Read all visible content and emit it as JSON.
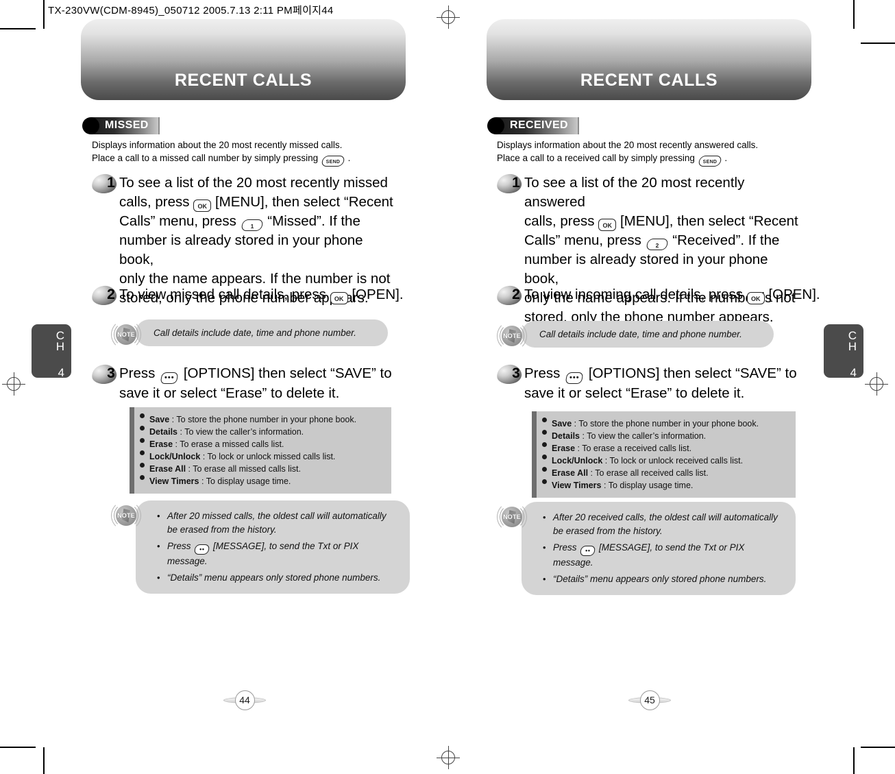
{
  "print_header": "TX-230VW(CDM-8945)_050712  2005.7.13 2:11 PM페이지44",
  "pages": [
    {
      "banner_title": "RECENT CALLS",
      "section_tag": "MISSED",
      "intro_line1": "Displays information about the 20 most recently missed calls.",
      "intro_line2_before": "Place a call to a missed call number by simply pressing",
      "intro_line2_after": ".",
      "send_key": "SEND",
      "step1": {
        "number": "1",
        "t1": "To see a list of the 20 most recently missed",
        "t2a": "calls, press",
        "ok_key": "OK",
        "t2b": "[MENU], then select “Recent",
        "t3a": "Calls” menu, press",
        "num_key": "1",
        "t3b": "“Missed”. If the",
        "t4": "number is already stored in your phone book,",
        "t5": "only the name appears. If the number is not",
        "t6": "stored, only the phone number appears."
      },
      "step2": {
        "number": "2",
        "t1": "To view missed call details, press",
        "ok_key": "OK",
        "t2": "[OPEN]."
      },
      "note1": "Call details include date, time and phone number.",
      "step3": {
        "number": "3",
        "t1a": "Press",
        "opt_key": "•••",
        "t1b": "[OPTIONS] then select “SAVE” to",
        "t2": "save it or select “Erase” to delete it."
      },
      "options": [
        {
          "name": "Save",
          "desc": " : To store the phone number in your phone book."
        },
        {
          "name": "Details",
          "desc": " : To view the caller’s information."
        },
        {
          "name": "Erase",
          "desc": " : To erase a missed calls list."
        },
        {
          "name": "Lock/Unlock",
          "desc": " : To lock or unlock missed calls list."
        },
        {
          "name": "Erase All",
          "desc": " : To erase all missed calls list."
        },
        {
          "name": "View Timers",
          "desc": " : To display usage time."
        }
      ],
      "note2": {
        "b1_l1": "After 20 missed calls, the oldest call will automatically",
        "b1_l2": "be erased from the history.",
        "b2a": "Press",
        "msg_key": "••",
        "b2b": "[MESSAGE], to send the Txt or PIX message.",
        "b3": "“Details” menu appears only stored phone numbers."
      },
      "chapter_label": "CH",
      "chapter_number": "4",
      "page_number": "44"
    },
    {
      "banner_title": "RECENT CALLS",
      "section_tag": "RECEIVED",
      "intro_line1": "Displays information about the 20 most recently answered calls.",
      "intro_line2_before": "Place a call to a received call by simply pressing",
      "intro_line2_after": ".",
      "send_key": "SEND",
      "step1": {
        "number": "1",
        "t1": "To see a list of the 20 most recently answered",
        "t2a": "calls, press",
        "ok_key": "OK",
        "t2b": "[MENU], then select “Recent",
        "t3a": "Calls” menu, press",
        "num_key": "2",
        "t3b": "“Received”. If the",
        "t4": "number is already stored in your phone book,",
        "t5": "only the name appears. If the number is not",
        "t6": "stored, only the phone number appears."
      },
      "step2": {
        "number": "2",
        "t1": "To view incoming call details, press",
        "ok_key": "OK",
        "t2": "[OPEN]."
      },
      "note1": "Call details include date, time and phone number.",
      "step3": {
        "number": "3",
        "t1a": "Press",
        "opt_key": "•••",
        "t1b": "[OPTIONS] then select “SAVE” to",
        "t2": "save it or select “Erase” to delete it."
      },
      "options": [
        {
          "name": "Save",
          "desc": " : To store the phone number in your phone book."
        },
        {
          "name": "Details",
          "desc": " : To view the caller’s information."
        },
        {
          "name": "Erase",
          "desc": " : To erase a received calls list."
        },
        {
          "name": "Lock/Unlock",
          "desc": " : To lock or unlock received calls list."
        },
        {
          "name": "Erase All",
          "desc": " : To erase all received calls list."
        },
        {
          "name": "View Timers",
          "desc": " : To display usage time."
        }
      ],
      "note2": {
        "b1_l1": "After 20 received calls, the oldest call will automatically",
        "b1_l2": "be erased from the history.",
        "b2a": "Press",
        "msg_key": "••",
        "b2b": "[MESSAGE], to send the Txt or PIX message.",
        "b3": "“Details” menu appears only stored phone numbers."
      },
      "chapter_label": "CH",
      "chapter_number": "4",
      "page_number": "45"
    }
  ],
  "note_badge_label": "NOTE"
}
